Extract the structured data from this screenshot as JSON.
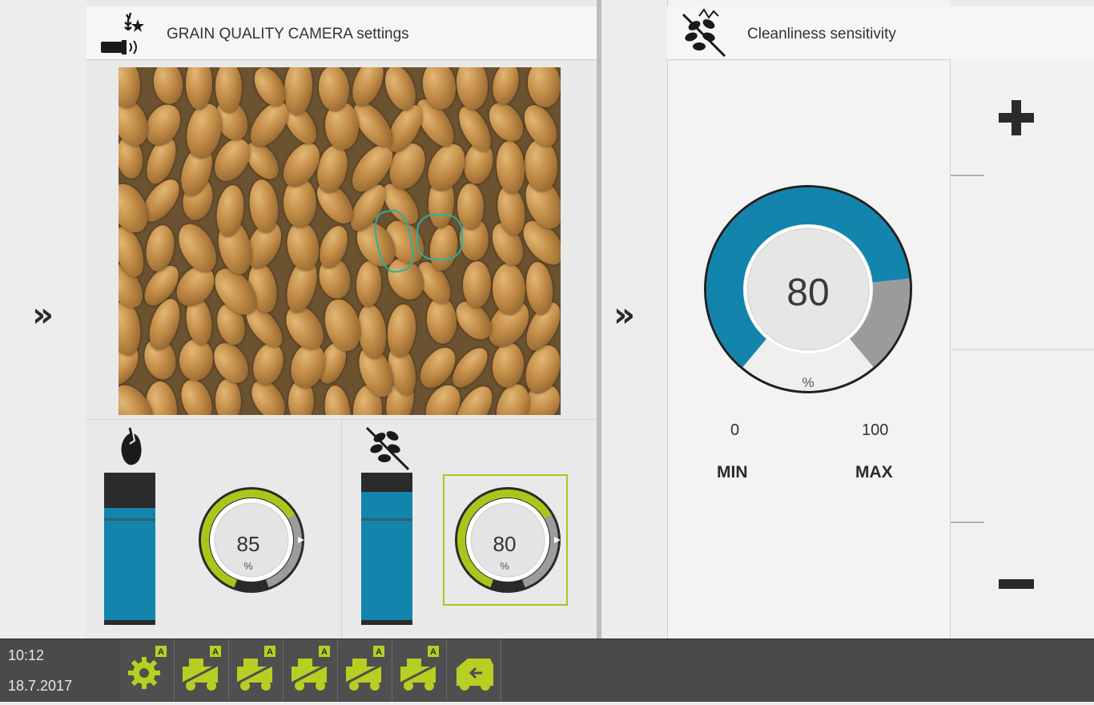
{
  "camera_panel": {
    "title": "GRAIN QUALITY CAMERA settings",
    "title_icon": "grain-camera-icon",
    "broken_grain": {
      "icon": "broken-grain-icon",
      "bar_level": 0.76,
      "dial_value": "85",
      "dial_unit": "%",
      "accent": "#a9c71a"
    },
    "cleanliness": {
      "icon": "cleanliness-icon",
      "bar_level": 0.87,
      "dial_value": "80",
      "dial_unit": "%",
      "accent": "#a9c71a",
      "selected": true
    }
  },
  "sensitivity_panel": {
    "title": "Cleanliness sensitivity",
    "title_icon": "cleanliness-sensitivity-icon",
    "value": "80",
    "unit": "%",
    "min_value": "0",
    "max_value": "100",
    "min_label": "MIN",
    "max_label": "MAX",
    "fill_percent": 80,
    "accent": "#1384ac"
  },
  "nav": {
    "left_chevron": "»",
    "mid_chevron": "»"
  },
  "footer": {
    "time": "10:12",
    "date": "18.7.2017",
    "icons": [
      {
        "name": "settings-gear-icon",
        "auto": "A"
      },
      {
        "name": "straw-chopper-icon",
        "auto": "A"
      },
      {
        "name": "threshing-drum-icon",
        "auto": "A"
      },
      {
        "name": "combine-harvester-icon",
        "auto": "A"
      },
      {
        "name": "grain-tank-icon",
        "auto": "A"
      },
      {
        "name": "unloading-auger-icon",
        "auto": "A"
      },
      {
        "name": "reverse-drive-icon",
        "auto": ""
      }
    ],
    "icon_color": "#b7cf22"
  }
}
